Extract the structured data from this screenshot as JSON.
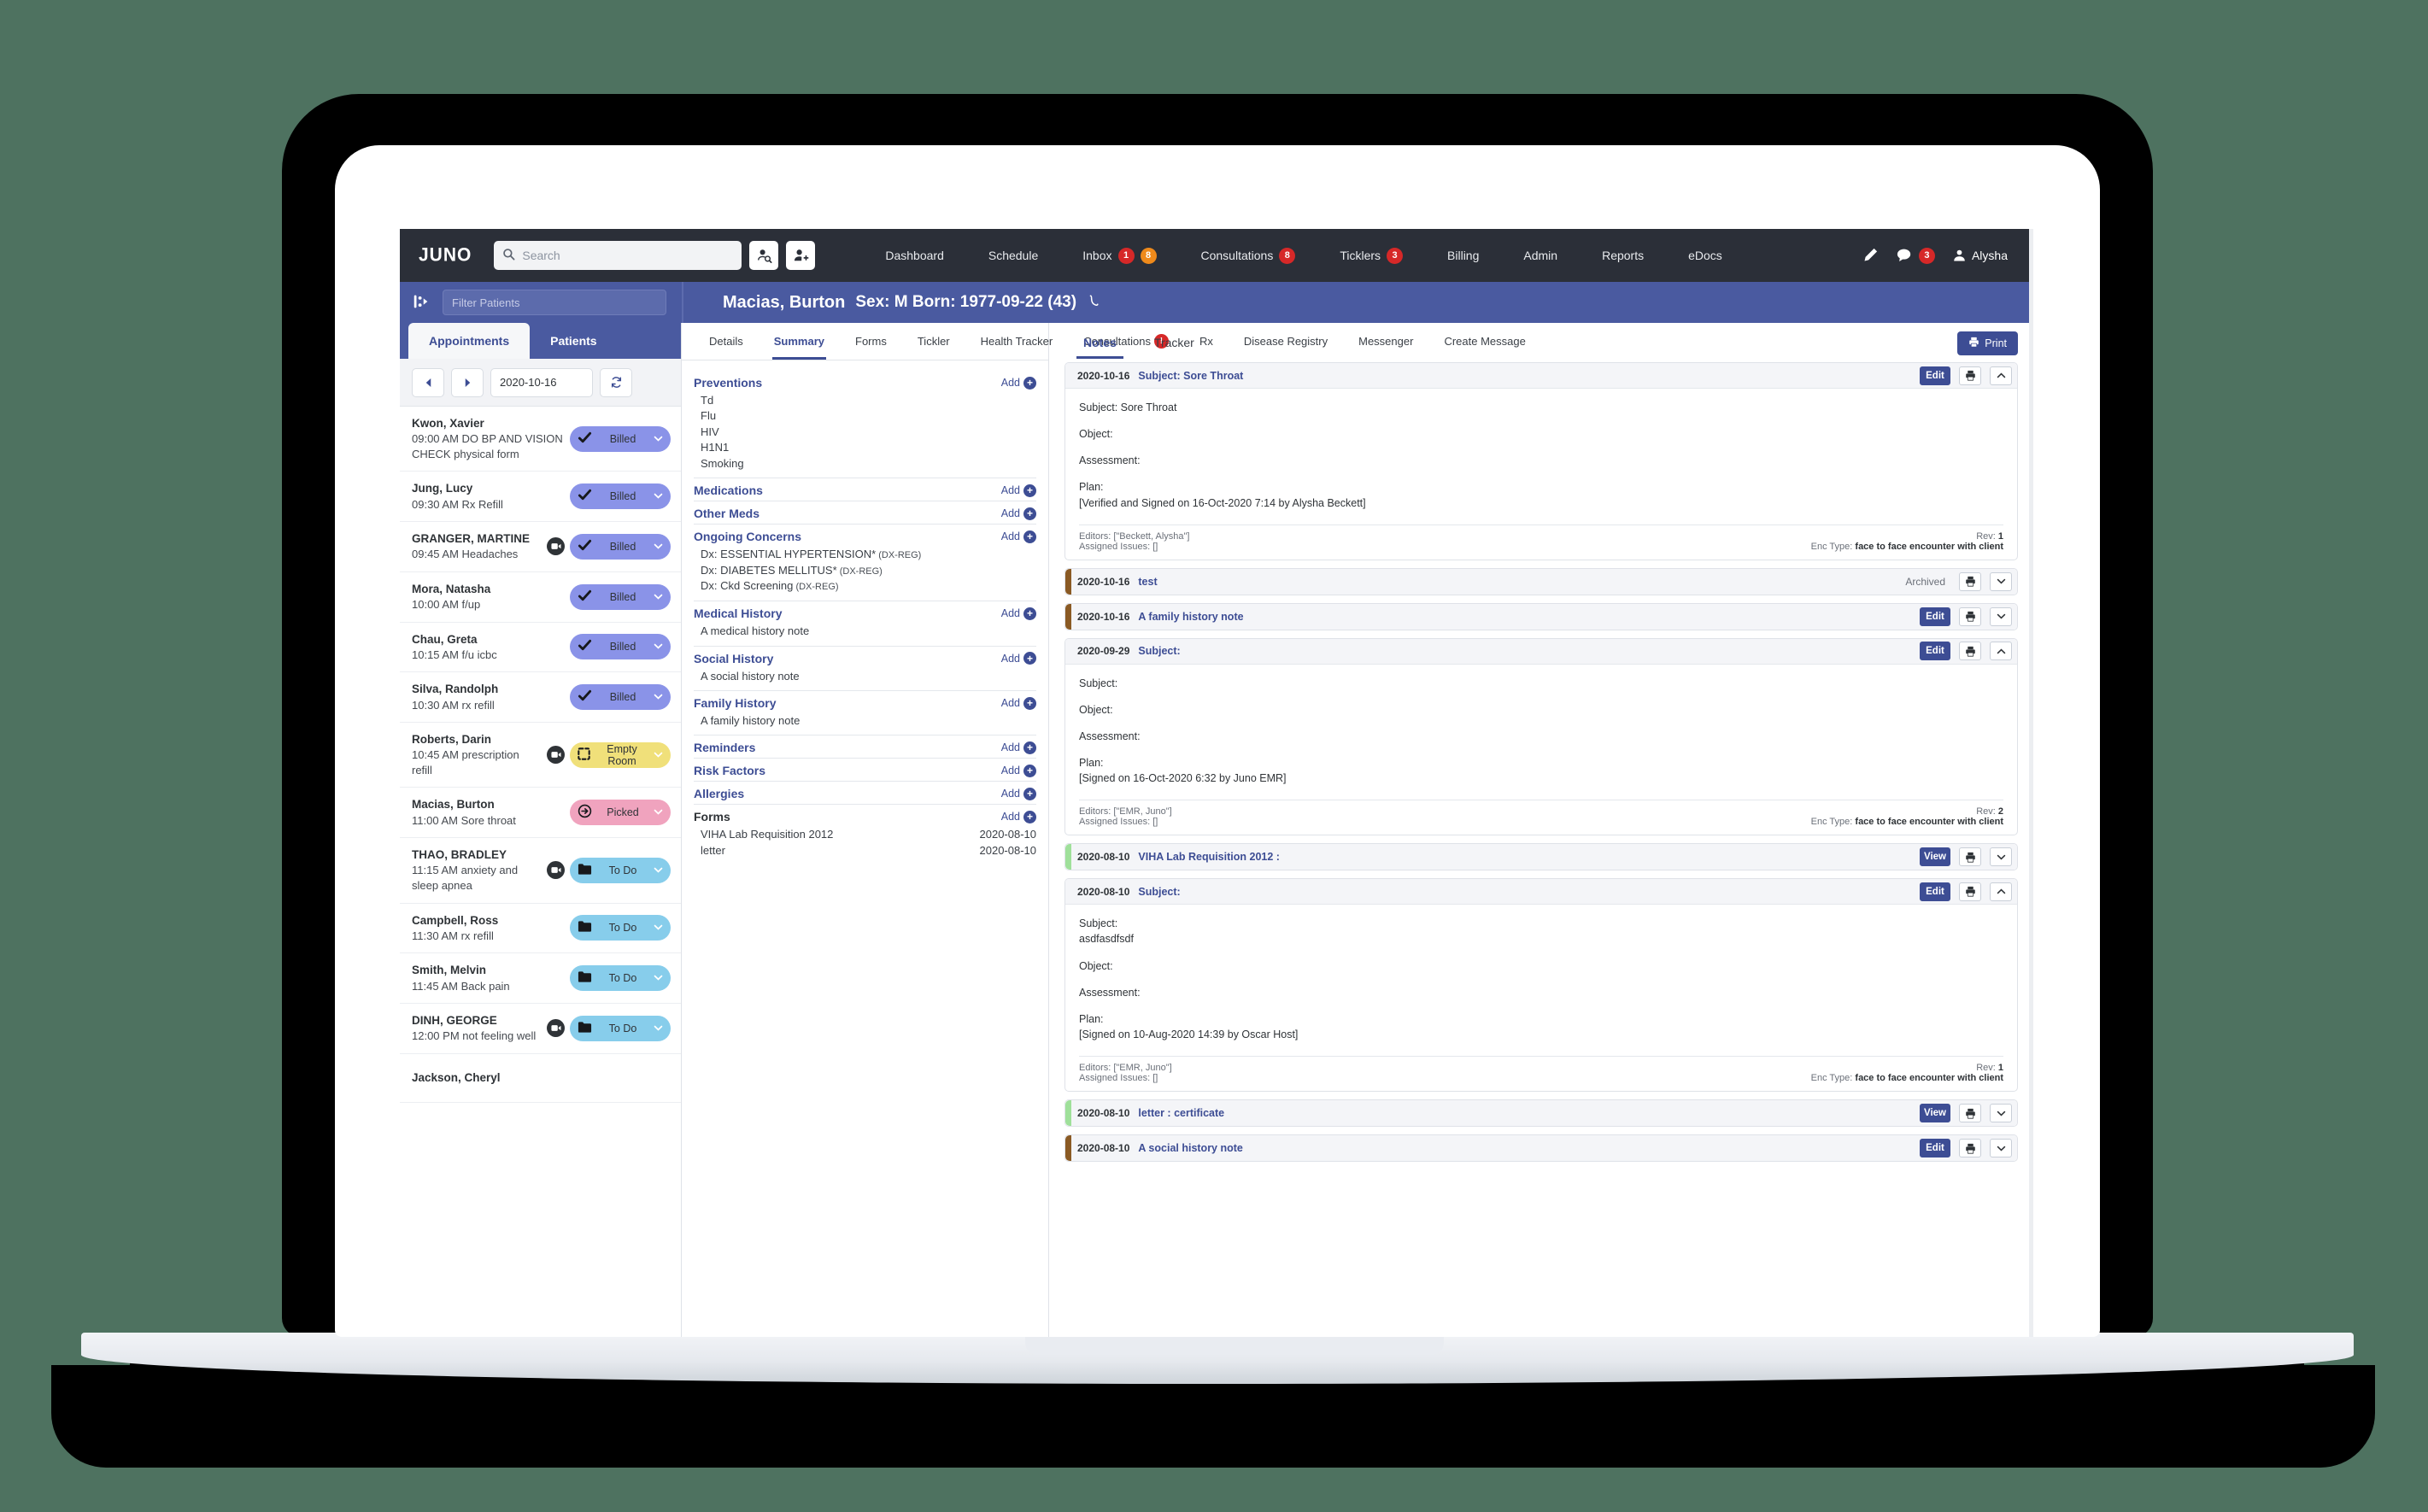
{
  "app": {
    "brand": "JUNO"
  },
  "search": {
    "placeholder": "Search",
    "value": ""
  },
  "topnav": {
    "items": [
      {
        "label": "Dashboard",
        "badges": []
      },
      {
        "label": "Schedule",
        "badges": []
      },
      {
        "label": "Inbox",
        "badges": [
          {
            "text": "1",
            "color": "red"
          },
          {
            "text": "8",
            "color": "orange"
          }
        ]
      },
      {
        "label": "Consultations",
        "badges": [
          {
            "text": "8",
            "color": "red"
          }
        ]
      },
      {
        "label": "Ticklers",
        "badges": [
          {
            "text": "3",
            "color": "red"
          }
        ]
      },
      {
        "label": "Billing",
        "badges": []
      },
      {
        "label": "Admin",
        "badges": []
      },
      {
        "label": "Reports",
        "badges": []
      },
      {
        "label": "eDocs",
        "badges": []
      }
    ],
    "message_badge": "3",
    "user": "Alysha"
  },
  "filter": {
    "placeholder": "Filter Patients",
    "value": ""
  },
  "patient": {
    "name": "Macias, Burton",
    "demographics": "Sex: M  Born: 1977-09-22 (43)"
  },
  "left_panel": {
    "tabs": [
      {
        "label": "Appointments",
        "active": true
      },
      {
        "label": "Patients",
        "active": false
      }
    ],
    "date": "2020-10-16",
    "appointments": [
      {
        "name": "Kwon, Xavier",
        "reason": "09:00 AM DO BP AND VISION CHECK physical form",
        "video": false,
        "status": "Billed",
        "status_style": "billed",
        "icon": "check"
      },
      {
        "name": "Jung, Lucy",
        "reason": "09:30 AM Rx Refill",
        "video": false,
        "status": "Billed",
        "status_style": "billed",
        "icon": "check"
      },
      {
        "name": "GRANGER, MARTINE",
        "reason": "09:45 AM Headaches",
        "video": true,
        "status": "Billed",
        "status_style": "billed",
        "icon": "check"
      },
      {
        "name": "Mora, Natasha",
        "reason": "10:00 AM f/up",
        "video": false,
        "status": "Billed",
        "status_style": "billed",
        "icon": "check"
      },
      {
        "name": "Chau, Greta",
        "reason": "10:15 AM f/u icbc",
        "video": false,
        "status": "Billed",
        "status_style": "billed",
        "icon": "check"
      },
      {
        "name": "Silva, Randolph",
        "reason": "10:30 AM rx refill",
        "video": false,
        "status": "Billed",
        "status_style": "billed",
        "icon": "check"
      },
      {
        "name": "Roberts, Darin",
        "reason": "10:45 AM prescription refill",
        "video": true,
        "status": "Empty Room",
        "status_style": "empty",
        "icon": "dashed-square"
      },
      {
        "name": "Macias, Burton",
        "reason": "11:00 AM Sore throat",
        "video": false,
        "status": "Picked",
        "status_style": "picked",
        "icon": "arrow-right-circle"
      },
      {
        "name": "THAO, BRADLEY",
        "reason": "11:15 AM anxiety and sleep apnea",
        "video": true,
        "status": "To Do",
        "status_style": "todo",
        "icon": "folder"
      },
      {
        "name": "Campbell, Ross",
        "reason": "11:30 AM rx refill",
        "video": false,
        "status": "To Do",
        "status_style": "todo",
        "icon": "folder"
      },
      {
        "name": "Smith, Melvin",
        "reason": "11:45 AM Back pain",
        "video": false,
        "status": "To Do",
        "status_style": "todo",
        "icon": "folder"
      },
      {
        "name": "DINH, GEORGE",
        "reason": "12:00 PM not feeling well",
        "video": true,
        "status": "To Do",
        "status_style": "todo",
        "icon": "folder"
      },
      {
        "name": "Jackson, Cheryl",
        "reason": "",
        "video": false,
        "status": "",
        "status_style": "todo",
        "icon": "folder"
      }
    ]
  },
  "patient_tabs": [
    {
      "label": "Details",
      "active": false,
      "badge": ""
    },
    {
      "label": "Summary",
      "active": true,
      "badge": ""
    },
    {
      "label": "Forms",
      "active": false,
      "badge": ""
    },
    {
      "label": "Tickler",
      "active": false,
      "badge": ""
    },
    {
      "label": "Health Tracker",
      "active": false,
      "badge": ""
    },
    {
      "label": "Consultations",
      "active": false,
      "badge": "!"
    },
    {
      "label": "Rx",
      "active": false,
      "badge": ""
    },
    {
      "label": "Disease Registry",
      "active": false,
      "badge": ""
    },
    {
      "label": "Messenger",
      "active": false,
      "badge": ""
    },
    {
      "label": "Create Message",
      "active": false,
      "badge": ""
    }
  ],
  "summary": {
    "add_label": "Add",
    "sections": [
      {
        "title": "Preventions",
        "dark": false,
        "items": [
          {
            "text": "Td"
          },
          {
            "text": "Flu"
          },
          {
            "text": "HIV"
          },
          {
            "text": "H1N1"
          },
          {
            "text": "Smoking"
          }
        ]
      },
      {
        "title": "Medications",
        "dark": false,
        "items": []
      },
      {
        "title": "Other Meds",
        "dark": false,
        "items": []
      },
      {
        "title": "Ongoing Concerns",
        "dark": false,
        "items": [
          {
            "text": "Dx: ESSENTIAL HYPERTENSION*",
            "small": "(DX-REG)"
          },
          {
            "text": "Dx: DIABETES MELLITUS*",
            "small": "(DX-REG)"
          },
          {
            "text": "Dx: Ckd Screening",
            "small": "(DX-REG)"
          }
        ]
      },
      {
        "title": "Medical History",
        "dark": false,
        "items": [
          {
            "text": "A medical history note"
          }
        ]
      },
      {
        "title": "Social History",
        "dark": false,
        "items": [
          {
            "text": "A social history note"
          }
        ]
      },
      {
        "title": "Family History",
        "dark": false,
        "items": [
          {
            "text": "A family history note"
          }
        ]
      },
      {
        "title": "Reminders",
        "dark": false,
        "items": []
      },
      {
        "title": "Risk Factors",
        "dark": false,
        "items": []
      },
      {
        "title": "Allergies",
        "dark": false,
        "items": []
      },
      {
        "title": "Forms",
        "dark": true,
        "items": [
          {
            "text": "VIHA Lab Requisition 2012",
            "right": "2020-08-10"
          },
          {
            "text": "letter",
            "right": "2020-08-10"
          }
        ]
      }
    ]
  },
  "notes_panel": {
    "tabs": [
      {
        "label": "Notes",
        "active": true
      },
      {
        "label": "Tracker",
        "active": false
      }
    ],
    "print_label": "Print",
    "notes": [
      {
        "date": "2020-10-16",
        "subject": "Subject: Sore Throat",
        "expanded": true,
        "stripe": "",
        "meta_right": "",
        "action": "Edit",
        "chevron": "^",
        "lines": [
          "Subject: Sore Throat",
          "Object:",
          "Assessment:",
          "Plan:\n[Verified and Signed on 16-Oct-2020 7:14 by Alysha Beckett]"
        ],
        "editors": "Editors: [\"Beckett, Alysha\"]",
        "assigned": "Assigned Issues: []",
        "rev_label": "Rev:",
        "rev": "1",
        "enc_label": "Enc Type:",
        "enc": "face to face encounter with client"
      },
      {
        "date": "2020-10-16",
        "subject": "test",
        "expanded": false,
        "stripe": "brown",
        "meta_right": "Archived",
        "action": "",
        "chevron": "v",
        "lines": [],
        "editors": "",
        "assigned": "",
        "rev_label": "",
        "rev": "",
        "enc_label": "",
        "enc": ""
      },
      {
        "date": "2020-10-16",
        "subject": "A family history note",
        "expanded": false,
        "stripe": "brown",
        "meta_right": "",
        "action": "Edit",
        "chevron": "v",
        "lines": [],
        "editors": "",
        "assigned": "",
        "rev_label": "",
        "rev": "",
        "enc_label": "",
        "enc": ""
      },
      {
        "date": "2020-09-29",
        "subject": "Subject:",
        "expanded": true,
        "stripe": "",
        "meta_right": "",
        "action": "Edit",
        "chevron": "^",
        "lines": [
          "Subject:",
          "Object:",
          "Assessment:",
          "Plan:\n[Signed on 16-Oct-2020 6:32 by Juno EMR]"
        ],
        "editors": "Editors: [\"EMR, Juno\"]",
        "assigned": "Assigned Issues: []",
        "rev_label": "Rev:",
        "rev": "2",
        "enc_label": "Enc Type:",
        "enc": "face to face encounter with client"
      },
      {
        "date": "2020-08-10",
        "subject": "VIHA Lab Requisition 2012 :",
        "expanded": false,
        "stripe": "green",
        "meta_right": "",
        "action": "View",
        "chevron": "v",
        "lines": [],
        "editors": "",
        "assigned": "",
        "rev_label": "",
        "rev": "",
        "enc_label": "",
        "enc": ""
      },
      {
        "date": "2020-08-10",
        "subject": "Subject:",
        "expanded": true,
        "stripe": "",
        "meta_right": "",
        "action": "Edit",
        "chevron": "^",
        "lines": [
          "Subject:\nasdfasdfsdf",
          "Object:",
          "Assessment:",
          "Plan:\n[Signed on 10-Aug-2020 14:39 by Oscar Host]"
        ],
        "editors": "Editors: [\"EMR, Juno\"]",
        "assigned": "Assigned Issues: []",
        "rev_label": "Rev:",
        "rev": "1",
        "enc_label": "Enc Type:",
        "enc": "face to face encounter with client"
      },
      {
        "date": "2020-08-10",
        "subject": "letter : certificate",
        "expanded": false,
        "stripe": "green",
        "meta_right": "",
        "action": "View",
        "chevron": "v",
        "lines": [],
        "editors": "",
        "assigned": "",
        "rev_label": "",
        "rev": "",
        "enc_label": "",
        "enc": ""
      },
      {
        "date": "2020-08-10",
        "subject": "A social history note",
        "expanded": false,
        "stripe": "brown",
        "meta_right": "",
        "action": "Edit",
        "chevron": "v",
        "lines": [],
        "editors": "",
        "assigned": "",
        "rev_label": "",
        "rev": "",
        "enc_label": "",
        "enc": ""
      }
    ]
  },
  "colors": {
    "nav_bg": "#2b2f38",
    "brand_blue": "#3d4d94",
    "header_blue": "#4a5aa0",
    "badge_red": "#d62828",
    "badge_orange": "#ef8a1b",
    "pill_billed": "#8a93e8",
    "pill_empty_room": "#f0e07a",
    "pill_picked": "#f0a3be",
    "pill_todo": "#87cdeb"
  }
}
